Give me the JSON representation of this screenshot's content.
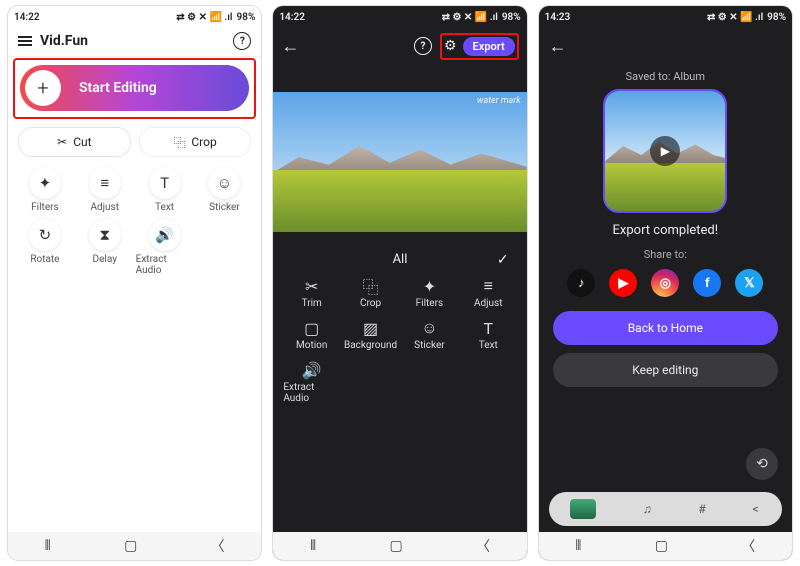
{
  "status": {
    "time_a": "14:22",
    "time_b": "14:23",
    "battery": "98%",
    "indicators_left": "⬚ ⬚ ⬛ ⬛ ·",
    "indicators_right": "⇄ ⚙ ✕ 📶 .ıl"
  },
  "phone1": {
    "title": "Vid.Fun",
    "start_label": "Start Editing",
    "cut_label": "Cut",
    "crop_label": "Crop",
    "tools": [
      {
        "icon": "✦",
        "label": "Filters"
      },
      {
        "icon": "≡",
        "label": "Adjust"
      },
      {
        "icon": "T",
        "label": "Text"
      },
      {
        "icon": "☺",
        "label": "Sticker"
      },
      {
        "icon": "↻",
        "label": "Rotate"
      },
      {
        "icon": "⧗",
        "label": "Delay"
      },
      {
        "icon": "🔊",
        "label": "Extract Audio"
      }
    ]
  },
  "phone2": {
    "export_label": "Export",
    "watermark": "water mark",
    "all_label": "All",
    "tools": [
      {
        "icon": "✂",
        "label": "Trim"
      },
      {
        "icon": "⿻",
        "label": "Crop"
      },
      {
        "icon": "✦",
        "label": "Filters"
      },
      {
        "icon": "≡",
        "label": "Adjust"
      },
      {
        "icon": "▢",
        "label": "Motion"
      },
      {
        "icon": "▨",
        "label": "Background"
      },
      {
        "icon": "☺",
        "label": "Sticker"
      },
      {
        "icon": "T",
        "label": "Text"
      },
      {
        "icon": "🔊",
        "label": "Extract Audio"
      }
    ]
  },
  "phone3": {
    "saved_to": "Saved to: Album",
    "done": "Export completed!",
    "share_to": "Share to:",
    "back_home": "Back to Home",
    "keep_editing": "Keep editing",
    "share": {
      "tiktok": "♪",
      "youtube": "▶",
      "instagram": "◎",
      "facebook": "f",
      "twitter": "𝕏"
    },
    "bottom": {
      "music": "♫",
      "hash": "#",
      "share": "<"
    }
  }
}
